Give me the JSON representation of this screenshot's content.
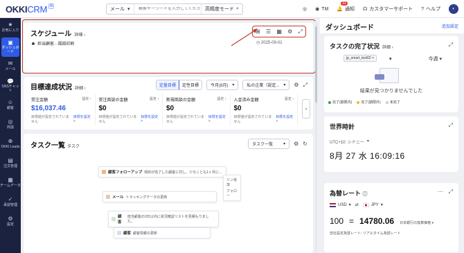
{
  "topbar": {
    "logo_main": "OKKI",
    "logo_sub": "CRM",
    "logo_badge": "AI",
    "search_scope": "メール",
    "search_placeholder": "検索キーワードを入力してください",
    "advanced_mode": "高精度モード",
    "user_initials": "TM",
    "notifications_label": "通知",
    "notifications_count": "31",
    "support_label": "カスタマーサポート",
    "help_label": "ヘルプ"
  },
  "leftnav": [
    {
      "label": "お気に入り",
      "icon": "star-icon",
      "glyph": "★"
    },
    {
      "label": "ダッシュボード",
      "icon": "dashboard-icon",
      "glyph": "▣",
      "active": true
    },
    {
      "label": "メール",
      "icon": "mail-icon",
      "glyph": "✉"
    },
    {
      "label": "SNSチャット",
      "icon": "chat-icon",
      "glyph": "💬"
    },
    {
      "label": "顧客",
      "icon": "customer-icon",
      "glyph": "☺"
    },
    {
      "label": "商談",
      "icon": "deal-icon",
      "glyph": "◎"
    },
    {
      "label": "OKKI Leads",
      "icon": "leads-icon",
      "glyph": "⊕"
    },
    {
      "label": "注文管理",
      "icon": "order-icon",
      "glyph": "▤"
    },
    {
      "label": "チームデータ",
      "icon": "team-data-icon",
      "glyph": "▦"
    },
    {
      "label": "承認管理",
      "icon": "approval-icon",
      "glyph": "✓"
    },
    {
      "label": "設定",
      "icon": "settings-icon",
      "glyph": "⚙"
    }
  ],
  "schedule": {
    "title": "スケジュール",
    "detail": "詳細",
    "item_label": "担当顧客 - 福田印刷",
    "item_date": "2025-09-01"
  },
  "goals": {
    "title": "目標達成状況",
    "detail": "詳細",
    "seg_quant": "定量目標",
    "seg_qual": "定性目標",
    "period": "今月(8月)",
    "company": "私の企業（設定...",
    "metrics": [
      {
        "label": "受注金額",
        "set": "設定",
        "value": "$16,037.46",
        "sub": "目標値が設定されていません",
        "link": "目標を設定 >",
        "blue": true
      },
      {
        "label": "受注商談の金額",
        "set": "設定",
        "value": "$0",
        "sub": "目標値が設定されていません",
        "link": "目標を設定 >"
      },
      {
        "label": "新規商談の金額",
        "set": "設定",
        "value": "$0",
        "sub": "目標値が設定されていません",
        "link": "目標を設定 >"
      },
      {
        "label": "入金済み金額",
        "set": "設定",
        "value": "$0",
        "sub": "目標値が設定されていません",
        "link": "目標を設定 >"
      }
    ],
    "next_partial": "新"
  },
  "tasks": {
    "title": "タスク一覧",
    "sub": "タスク",
    "view": "タスク一覧",
    "illus": [
      {
        "title": "顧客フォローアップ",
        "text": "契約が完了した顧客に対し、少なくとも1ヶ月に..."
      },
      {
        "title": "メール",
        "text": "トラッキングデータの更新"
      },
      {
        "title": "顧客",
        "text": "担当顧客の3日以内に状況確認リストを見積もりました。"
      },
      {
        "title": "顧客",
        "text": "顧客情報の更新"
      }
    ],
    "illus_side1": "リン追加",
    "illus_side2": "フォロー"
  },
  "dashboard": {
    "title": "ダッシュボード",
    "add": "追加設定"
  },
  "task_status": {
    "title": "タスクの完了状況",
    "detail": "詳細",
    "tag": "jp_smart_test02",
    "period": "今週",
    "empty": "結果が見つかりませんでした",
    "legend": [
      {
        "label": "完了(期限内)",
        "color": "#2e9e5b"
      },
      {
        "label": "完了(期限外)",
        "color": "#f0b429"
      },
      {
        "label": "未完了",
        "color": "#c9ced8"
      }
    ]
  },
  "world_clock": {
    "title": "世界時計",
    "tz": "UTC+10: シドニー",
    "time": "8月 27  水  16:09:16"
  },
  "fx": {
    "title": "為替レート",
    "from": "USD",
    "to": "JPY",
    "amount": "100",
    "equals": "=",
    "result": "14780.06",
    "note": "日本銀行の換算価格",
    "foot": "自社設定為替レート: リアルタイム為替レート"
  }
}
